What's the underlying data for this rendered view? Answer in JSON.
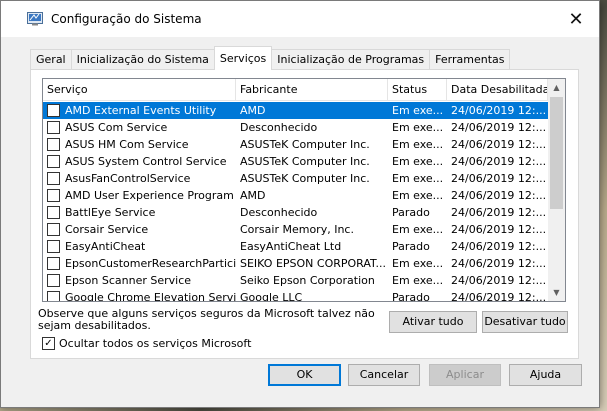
{
  "window": {
    "title": "Configuração do Sistema",
    "close_glyph": "✕"
  },
  "tabs": [
    {
      "label": "Geral"
    },
    {
      "label": "Inicialização do Sistema"
    },
    {
      "label": "Serviços"
    },
    {
      "label": "Inicialização de Programas"
    },
    {
      "label": "Ferramentas"
    }
  ],
  "active_tab": "Serviços",
  "list": {
    "columns": [
      "Serviço",
      "Fabricante",
      "Status",
      "Data Desabilitada"
    ],
    "rows": [
      {
        "service": "AMD External Events Utility",
        "manufacturer": "AMD",
        "status": "Em exe...",
        "date": "24/06/2019 12:...",
        "checked": false,
        "selected": true
      },
      {
        "service": "ASUS Com Service",
        "manufacturer": "Desconhecido",
        "status": "Em exe...",
        "date": "24/06/2019 12:...",
        "checked": false,
        "selected": false
      },
      {
        "service": "ASUS HM Com Service",
        "manufacturer": "ASUSTeK Computer Inc.",
        "status": "Em exe...",
        "date": "24/06/2019 12:...",
        "checked": false,
        "selected": false
      },
      {
        "service": "ASUS System Control Service",
        "manufacturer": "ASUSTeK Computer Inc.",
        "status": "Em exe...",
        "date": "24/06/2019 12:...",
        "checked": false,
        "selected": false
      },
      {
        "service": "AsusFanControlService",
        "manufacturer": "ASUSTeK Computer Inc.",
        "status": "Em exe...",
        "date": "24/06/2019 12:...",
        "checked": false,
        "selected": false
      },
      {
        "service": "AMD User Experience Program L...",
        "manufacturer": "AMD",
        "status": "Em exe...",
        "date": "24/06/2019 12:...",
        "checked": false,
        "selected": false
      },
      {
        "service": "BattlEye Service",
        "manufacturer": "Desconhecido",
        "status": "Parado",
        "date": "24/06/2019 12:...",
        "checked": false,
        "selected": false
      },
      {
        "service": "Corsair Service",
        "manufacturer": "Corsair Memory, Inc.",
        "status": "Em exe...",
        "date": "24/06/2019 12:...",
        "checked": false,
        "selected": false
      },
      {
        "service": "EasyAntiCheat",
        "manufacturer": "EasyAntiCheat Ltd",
        "status": "Parado",
        "date": "24/06/2019 12:...",
        "checked": false,
        "selected": false
      },
      {
        "service": "EpsonCustomerResearchParticip...",
        "manufacturer": "SEIKO EPSON CORPORAT...",
        "status": "Em exe...",
        "date": "24/06/2019 12:...",
        "checked": false,
        "selected": false
      },
      {
        "service": "Epson Scanner Service",
        "manufacturer": "Seiko Epson Corporation",
        "status": "Em exe...",
        "date": "24/06/2019 12:...",
        "checked": false,
        "selected": false
      },
      {
        "service": "Google Chrome Elevation Service",
        "manufacturer": "Google LLC",
        "status": "Parado",
        "date": "24/06/2019 12:...",
        "checked": false,
        "selected": false
      }
    ]
  },
  "note": "Observe que alguns serviços seguros da Microsoft talvez não sejam desabilitados.",
  "buttons": {
    "enable_all": "Ativar tudo",
    "disable_all": "Desativar tudo",
    "ok": "OK",
    "cancel": "Cancelar",
    "apply": "Aplicar",
    "help": "Ajuda"
  },
  "hide_microsoft": {
    "label": "Ocultar todos os serviços Microsoft",
    "checked": true
  },
  "colors": {
    "selection": "#0078d7",
    "window_bg": "#f0f0f0"
  }
}
